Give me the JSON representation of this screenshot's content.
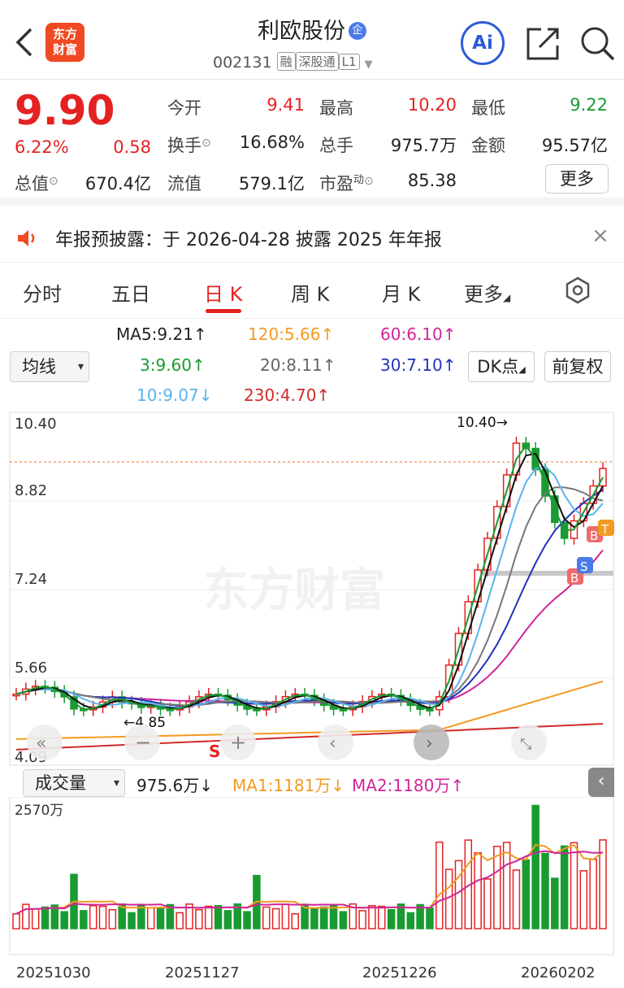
{
  "header": {
    "logo_text": "东方\n财富",
    "name": "利欧股份",
    "name_badge": "企",
    "code": "002131",
    "tags": [
      "融",
      "深股通",
      "L1"
    ],
    "ai_label": "Ai"
  },
  "quote": {
    "price": "9.90",
    "pct": "6.22%",
    "chg": "0.58",
    "open_label": "今开",
    "open": "9.41",
    "high_label": "最高",
    "high": "10.20",
    "low_label": "最低",
    "low": "9.22",
    "turnover_label": "换手",
    "turnover": "16.68%",
    "vol_label": "总手",
    "vol": "975.7万",
    "amount_label": "金额",
    "amount": "95.57亿",
    "mcap_label": "总值",
    "mcap": "670.4亿",
    "float_label": "流值",
    "float": "579.1亿",
    "pe_label": "市盈",
    "pe_sup": "动",
    "pe": "85.38",
    "more": "更多"
  },
  "notice": {
    "text": "年报预披露：于 2026-04-28 披露 2025 年年报"
  },
  "tabs": [
    "分时",
    "五日",
    "日 K",
    "周 K",
    "月 K",
    "更多"
  ],
  "ma": {
    "ma5": "MA5:9.21",
    "ma120": "120:5.66",
    "ma60": "60:6.10",
    "ma3": "3:9.60",
    "ma20": "20:8.11",
    "ma30": "30:7.10",
    "ma10": "10:9.07",
    "ma230": "230:4.70",
    "ind_sel": "均线",
    "dk": "DK点",
    "fq": "前复权"
  },
  "kline": {
    "y_ticks": [
      "10.40",
      "8.82",
      "7.24",
      "5.66",
      "4.09"
    ],
    "high_label": "10.40",
    "low_label": "4.85",
    "watermark": "东方财富",
    "markers": [
      "B",
      "S",
      "B",
      "T",
      "S"
    ],
    "colors": {
      "up": "#e52222",
      "down": "#1a9b32",
      "ma5": "#111111",
      "ma3": "#1a9b32",
      "ma10": "#5ab4ee",
      "ma20": "#777777",
      "ma30": "#2233bb",
      "ma60": "#d0259a",
      "ma120": "#f29b22",
      "ma230": "#d12a2a"
    }
  },
  "volume": {
    "sel": "成交量",
    "value": "975.6万",
    "ma1": "MA1:1181万",
    "ma2": "MA2:1180万",
    "max_label": "2570万",
    "dates": [
      "20251030",
      "20251127",
      "20251226",
      "20260202"
    ]
  }
}
